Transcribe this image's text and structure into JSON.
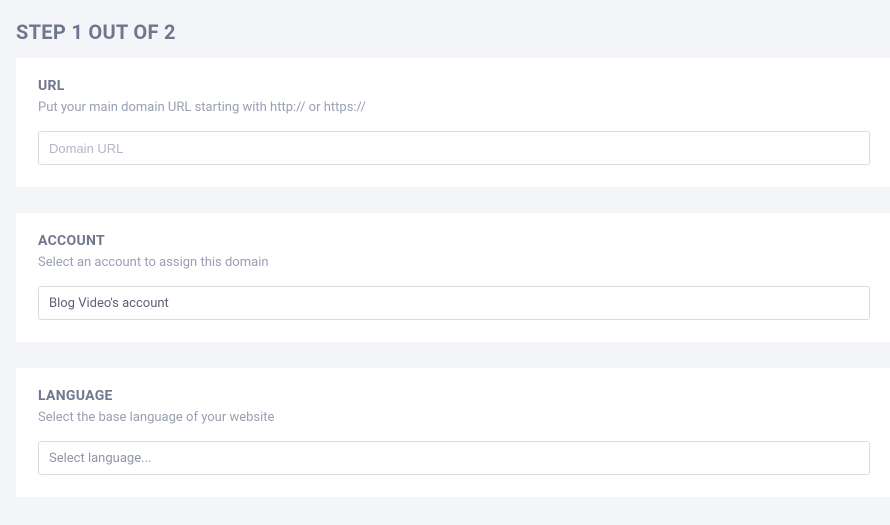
{
  "header": {
    "title": "STEP 1 OUT OF 2"
  },
  "sections": {
    "url": {
      "label": "URL",
      "helper": "Put your main domain URL starting with http:// or https://",
      "placeholder": "Domain URL",
      "value": ""
    },
    "account": {
      "label": "ACCOUNT",
      "helper": "Select an account to assign this domain",
      "selected": "Blog Video's account"
    },
    "language": {
      "label": "LANGUAGE",
      "helper": "Select the base language of your website",
      "placeholder": "Select language..."
    }
  }
}
